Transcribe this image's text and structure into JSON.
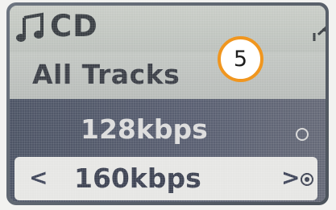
{
  "status": {
    "source_label": "CD",
    "note_icon": "music-note-icon",
    "signal_icon": "signal-icon"
  },
  "callout": {
    "number": "5",
    "color": "#f0961f"
  },
  "menu": {
    "title": "All Tracks"
  },
  "options": [
    {
      "label": "128kbps",
      "selected": false
    },
    {
      "label": "160kbps",
      "selected": true
    }
  ],
  "controls": {
    "prev_glyph": "<",
    "next_glyph": ">"
  }
}
